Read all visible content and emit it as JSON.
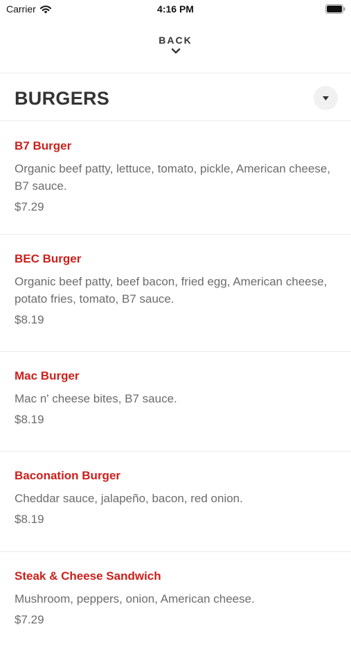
{
  "status_bar": {
    "carrier": "Carrier",
    "time": "4:16 PM",
    "icons": [
      "wifi-icon",
      "battery-icon"
    ]
  },
  "navigation": {
    "back_label": "BACK",
    "back_icon": "chevron-down-icon"
  },
  "category": {
    "title": "BURGERS",
    "dropdown_icon": "caret-down-icon"
  },
  "colors": {
    "item_name": "#cc1f1a",
    "text_secondary": "#6b6b6b",
    "heading": "#333333"
  },
  "menu_items": [
    {
      "name": "B7 Burger",
      "description": "Organic beef patty, lettuce, tomato, pickle, American cheese, B7 sauce.",
      "price": "$7.29"
    },
    {
      "name": "BEC Burger",
      "description": "Organic beef patty, beef bacon, fried egg, American cheese, potato fries, tomato, B7 sauce.",
      "price": "$8.19"
    },
    {
      "name": "Mac Burger",
      "description": "Mac n' cheese bites, B7 sauce.",
      "price": "$8.19"
    },
    {
      "name": "Baconation Burger",
      "description": "Cheddar sauce, jalapeño, bacon, red onion.",
      "price": "$8.19"
    },
    {
      "name": "Steak & Cheese Sandwich",
      "description": "Mushroom, peppers, onion, American cheese.",
      "price": "$7.29"
    }
  ]
}
